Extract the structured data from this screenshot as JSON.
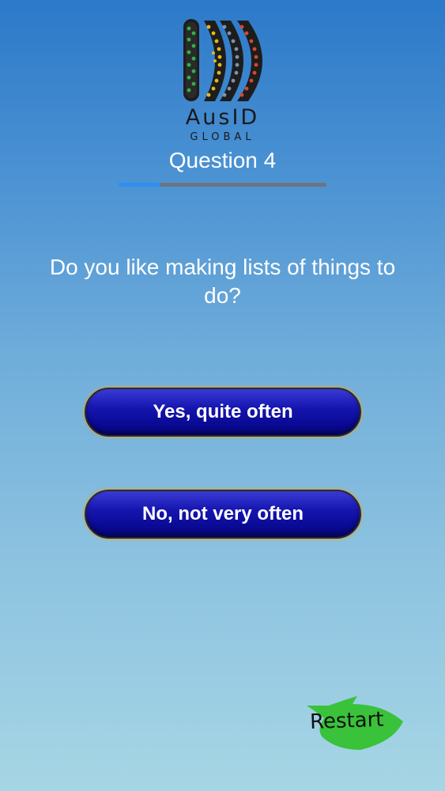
{
  "logo": {
    "brand": "AusID",
    "sub": "GLOBAL",
    "colors": [
      "#1f8a3a",
      "#e0b21a",
      "#6a7f9a",
      "#c8402a"
    ]
  },
  "header": {
    "question_label": "Question 4"
  },
  "progress": {
    "fraction": 0.2,
    "track_color": "#6d7480",
    "fill_color": "#2f8ef3"
  },
  "question": {
    "text": "Do you like making lists of things to do?"
  },
  "answers": [
    {
      "label": "Yes, quite often"
    },
    {
      "label": "No, not very often"
    }
  ],
  "restart": {
    "label": "Restart",
    "icon": "green-arrow-icon",
    "color": "#39c23a"
  }
}
